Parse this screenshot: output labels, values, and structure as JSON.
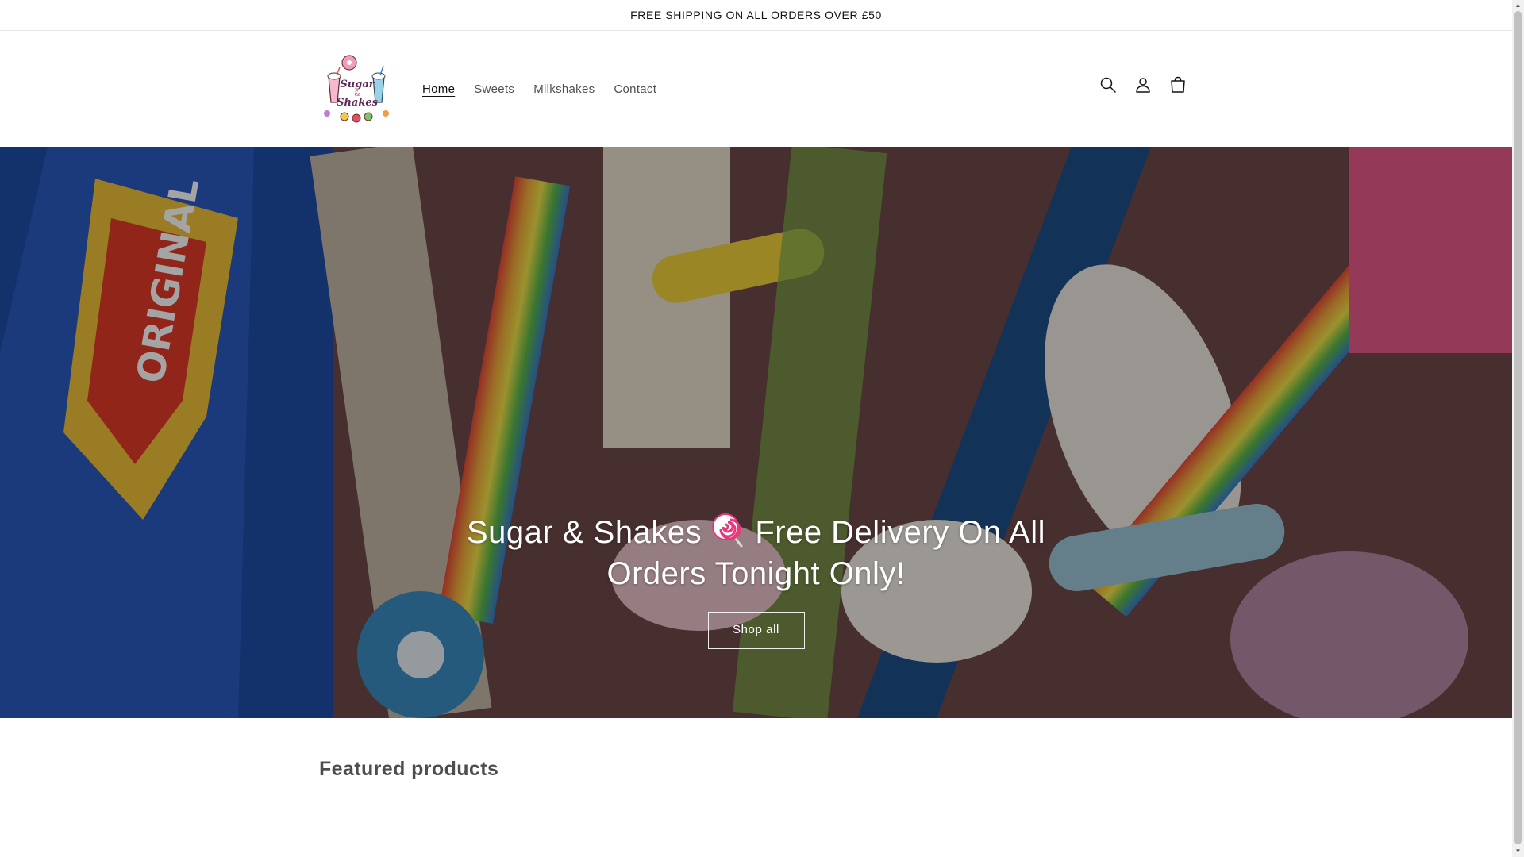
{
  "announcement": {
    "text": "FREE SHIPPING ON ALL ORDERS OVER £50"
  },
  "header": {
    "logo_text": "Sugar & Shakes",
    "nav": [
      {
        "label": "Home",
        "active": true
      },
      {
        "label": "Sweets",
        "active": false
      },
      {
        "label": "Milkshakes",
        "active": false
      },
      {
        "label": "Contact",
        "active": false
      }
    ],
    "icons": [
      "search-icon",
      "account-icon",
      "cart-icon"
    ]
  },
  "hero": {
    "title_before": "Sugar & Shakes",
    "title_emoji": "lollipop-icon",
    "title_after": "Free Delivery On All Orders Tonight Only!",
    "button_label": "Shop all"
  },
  "featured": {
    "heading": "Featured products"
  },
  "colors": {
    "text": "#121212",
    "accent": "#121212",
    "background": "#ffffff"
  }
}
